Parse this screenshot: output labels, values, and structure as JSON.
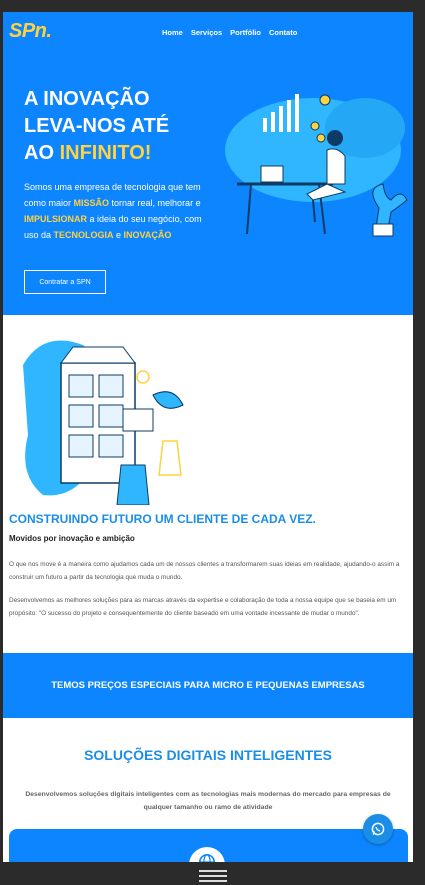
{
  "brand": {
    "logo": "SPn."
  },
  "nav": {
    "items": [
      "Home",
      "Serviços",
      "Portfólio",
      "Contato"
    ]
  },
  "hero": {
    "headline_1": "A INOVAÇÃO",
    "headline_2": "LEVA-NOS ATÉ",
    "headline_3a": "AO ",
    "headline_3b": "INFINITO!",
    "lead": {
      "p1": "Somos uma empresa de tecnologia que tem como maior ",
      "missao": "MISSÃO",
      "p2": " tornar real, melhorar e ",
      "impulsionar": "IMPULSIONAR",
      "p3": " a ideia do seu negócio, com uso da ",
      "tecnologia": "TECNOLOGIA",
      "p4": " e ",
      "inovacao": "INOVAÇÃO"
    },
    "cta": "Contratar a SPN"
  },
  "about": {
    "title": "CONSTRUINDO FUTURO UM CLIENTE DE CADA VEZ.",
    "subtitle": "Movidos por inovação e ambição",
    "para1": "O que nos move é a maneira como ajudamos cada um de nossos clientes a transformarem suas ideias em realidade, ajudando-o assim a construir um futuro a partir da tecnologia que muda o mundo.",
    "para2": "Desenvolvemos as melhores soluções para as marcas através da expertise e colaboração de toda a nossa equipe que se baseia em um propósito: \"O sucesso do projeto e consequentemente do cliente baseado em uma vontade incessante de mudar o mundo\"."
  },
  "banner": {
    "text": "TEMOS PREÇOS ESPECIAIS PARA MICRO E PEQUENAS EMPRESAS"
  },
  "solutions": {
    "title": "SOLUÇÕES DIGITAIS INTELIGENTES",
    "description": "Desenvolvemos soluções digitais inteligentes com as tecnologias mais modernas do mercado para empresas de qualquer tamanho ou ramo de atividade"
  },
  "icons": {
    "chat": "whatsapp-icon",
    "card": "globe-icon",
    "menu": "hamburger-menu-icon"
  },
  "colors": {
    "primary": "#0d85ff",
    "accent": "#ffd23f",
    "heading_blue": "#1a8ee6"
  }
}
